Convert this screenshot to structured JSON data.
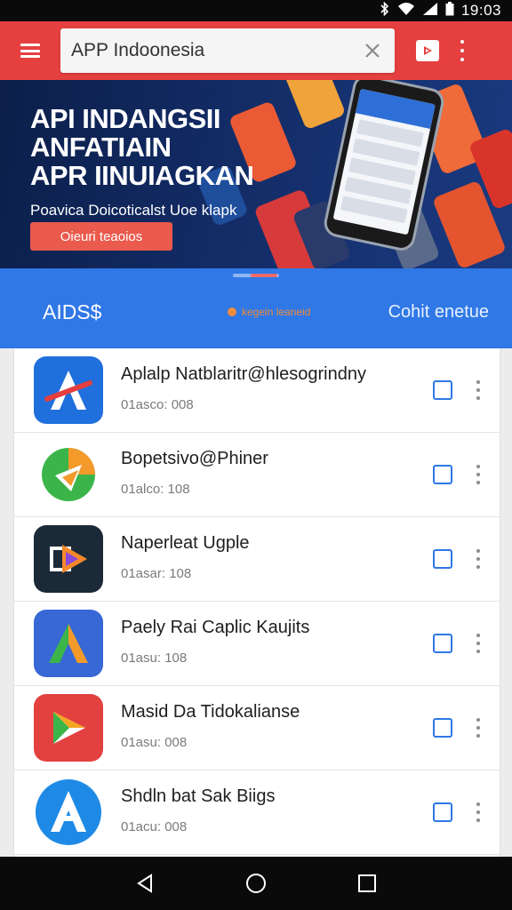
{
  "status_bar": {
    "time": "19:03",
    "icons": [
      "bluetooth-icon",
      "wifi-icon",
      "signal-icon",
      "battery-icon"
    ]
  },
  "app_bar": {
    "menu_icon": "hamburger-menu-icon",
    "search_value": "APP Indoonesia",
    "clear_icon": "close-icon",
    "store_icon": "play-store-icon",
    "overflow_icon": "more-vertical-icon"
  },
  "banner": {
    "title_lines": [
      "API INDANGSII",
      "ANFATIAIN",
      "APR IINUIAGKAN"
    ],
    "subtitle": "Poavica Doicoticalst Uoe klapk",
    "cta_label": "Oieuri teaoios"
  },
  "tabs": {
    "left": "AIDS$",
    "middle": "kegein leaneid",
    "right": "Cohit enetue"
  },
  "apps": [
    {
      "name": "Aplalp Natblaritr@hlesogrindny",
      "meta": "01asco: 008",
      "icon": "app-icon-red-a"
    },
    {
      "name": "Bopetsivo@Phiner",
      "meta": "01alco: 108",
      "icon": "app-icon-green-orange"
    },
    {
      "name": "Naperleat Ugple",
      "meta": "01asar: 108",
      "icon": "app-icon-dark-play"
    },
    {
      "name": "Paely Rai Caplic Kaujits",
      "meta": "01asu: 108",
      "icon": "app-icon-blue-a"
    },
    {
      "name": "Masid Da Tidokalianse",
      "meta": "01asu: 008",
      "icon": "app-icon-red-play"
    },
    {
      "name": "Shdln bat Sak Biigs",
      "meta": "01acu: 008",
      "icon": "app-icon-circle-a"
    }
  ],
  "colors": {
    "app_bar": "#e53f3f",
    "tab_bar": "#2f78e6",
    "accent_orange": "#f08b3c",
    "cta": "#ea5a4d"
  }
}
